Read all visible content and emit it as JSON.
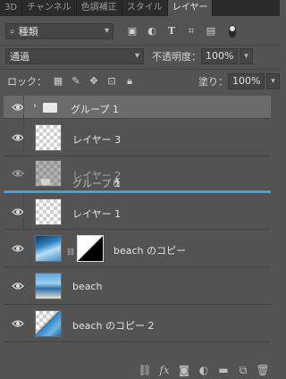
{
  "tabs": [
    {
      "label": "3D"
    },
    {
      "label": "チャンネル"
    },
    {
      "label": "色調補正"
    },
    {
      "label": "スタイル"
    },
    {
      "label": "レイヤー",
      "active": true
    }
  ],
  "filter": {
    "kind_label": "種類"
  },
  "blend": {
    "mode": "通過",
    "opacity_label": "不透明度：",
    "opacity_value": "100%"
  },
  "lock": {
    "label": "ロック：",
    "fill_label": "塗り：",
    "fill_value": "100%"
  },
  "layers": [
    {
      "name": "グループ 1",
      "type": "group"
    },
    {
      "name": "レイヤー 3",
      "type": "layer"
    },
    {
      "name": "レイヤー 2",
      "type": "layer",
      "ghost_label": "グループ 1"
    },
    {
      "name": "レイヤー 1",
      "type": "layer"
    },
    {
      "name": "beach のコピー",
      "type": "layer-with-mask"
    },
    {
      "name": "beach",
      "type": "image"
    },
    {
      "name": "beach のコピー 2",
      "type": "image"
    }
  ],
  "colors": {
    "accent": "#4a9fd8",
    "panel": "#535353",
    "tabbar": "#2b2b2b"
  },
  "icons": [
    "search-icon",
    "image-filter-icon",
    "adjustment-filter-icon",
    "type-filter-icon",
    "shape-filter-icon",
    "smart-object-filter-icon",
    "filter-toggle-icon",
    "lock-transparent-icon",
    "lock-paint-icon",
    "lock-position-icon",
    "lock-artboard-icon",
    "lock-all-icon",
    "eye-icon",
    "folder-icon",
    "link-icon",
    "fx-icon",
    "mask-icon",
    "adjustment-icon",
    "new-group-icon",
    "new-layer-icon",
    "trash-icon"
  ]
}
